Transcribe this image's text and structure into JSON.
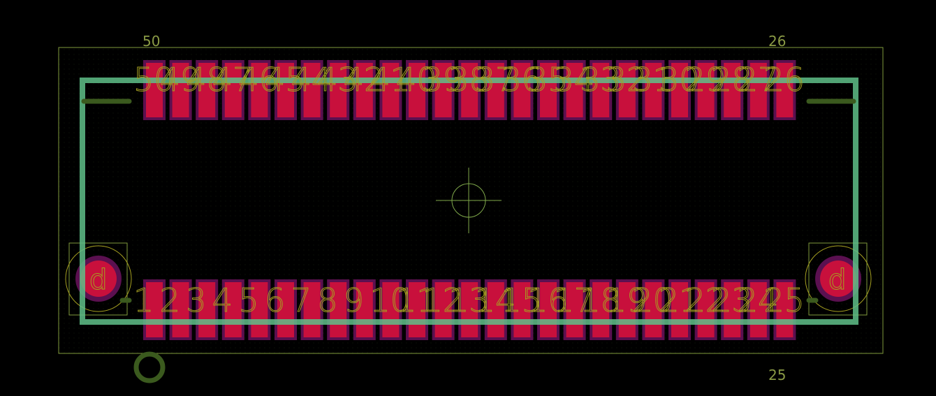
{
  "labels": {
    "top_left": "50",
    "top_right": "26",
    "bottom_right": "25"
  },
  "pins": {
    "top": [
      "50",
      "49",
      "48",
      "47",
      "46",
      "45",
      "44",
      "43",
      "42",
      "41",
      "40",
      "39",
      "38",
      "37",
      "36",
      "35",
      "34",
      "33",
      "32",
      "31",
      "30",
      "29",
      "28",
      "27",
      "26"
    ],
    "bottom": [
      "1",
      "2",
      "3",
      "4",
      "5",
      "6",
      "7",
      "8",
      "9",
      "10",
      "11",
      "12",
      "13",
      "14",
      "15",
      "16",
      "17",
      "18",
      "19",
      "20",
      "21",
      "22",
      "23",
      "24",
      "25"
    ]
  },
  "mounting_pads": {
    "left_label": "d",
    "right_label": "d"
  },
  "colors": {
    "background": "#000000",
    "board_outline": "#7f9a3c",
    "pad_fill": "#c8103c",
    "pad_mask": "#5b1050",
    "courtyard": "#5fbf88",
    "silkscreen_text": "#a6a020",
    "pin1_marker": "#3b5a1e",
    "crosshair": "#7fa84a"
  }
}
